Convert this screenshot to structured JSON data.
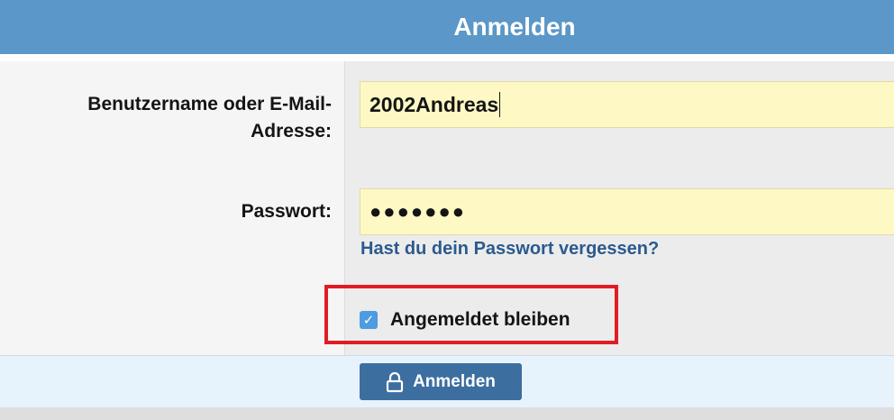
{
  "header": {
    "title": "Anmelden"
  },
  "form": {
    "username_label": "Benutzername oder E-Mail-Adresse:",
    "username_value": "2002Andreas",
    "password_label": "Passwort:",
    "password_value": "●●●●●●●",
    "forgot_link": "Hast du dein Passwort vergessen?",
    "remember_label": "Angemeldet bleiben",
    "remember_checked": true,
    "checkbox_mark": "✓"
  },
  "footer": {
    "submit_label": "Anmelden",
    "submit_icon": "lock-icon"
  },
  "colors": {
    "header_bg": "#5b97c8",
    "input_bg": "#fdf8c4",
    "link": "#2b5a8e",
    "checkbox": "#4d9be0",
    "highlight": "#e01c24",
    "button": "#3c6e9f",
    "footer_bg": "#e6f2fc"
  }
}
